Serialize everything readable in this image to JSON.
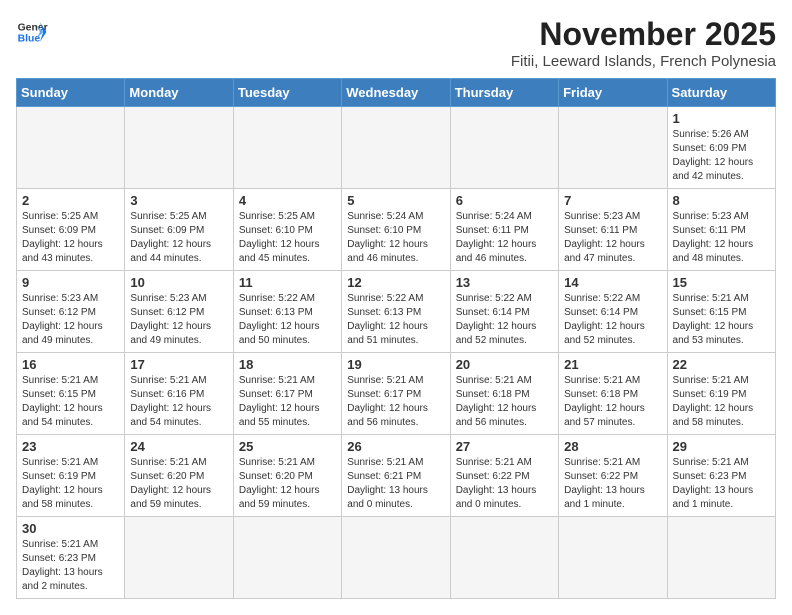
{
  "header": {
    "logo_line1": "General",
    "logo_line2": "Blue",
    "month": "November 2025",
    "location": "Fitii, Leeward Islands, French Polynesia"
  },
  "weekdays": [
    "Sunday",
    "Monday",
    "Tuesday",
    "Wednesday",
    "Thursday",
    "Friday",
    "Saturday"
  ],
  "weeks": [
    [
      {
        "day": "",
        "info": ""
      },
      {
        "day": "",
        "info": ""
      },
      {
        "day": "",
        "info": ""
      },
      {
        "day": "",
        "info": ""
      },
      {
        "day": "",
        "info": ""
      },
      {
        "day": "",
        "info": ""
      },
      {
        "day": "1",
        "info": "Sunrise: 5:26 AM\nSunset: 6:09 PM\nDaylight: 12 hours\nand 42 minutes."
      }
    ],
    [
      {
        "day": "2",
        "info": "Sunrise: 5:25 AM\nSunset: 6:09 PM\nDaylight: 12 hours\nand 43 minutes."
      },
      {
        "day": "3",
        "info": "Sunrise: 5:25 AM\nSunset: 6:09 PM\nDaylight: 12 hours\nand 44 minutes."
      },
      {
        "day": "4",
        "info": "Sunrise: 5:25 AM\nSunset: 6:10 PM\nDaylight: 12 hours\nand 45 minutes."
      },
      {
        "day": "5",
        "info": "Sunrise: 5:24 AM\nSunset: 6:10 PM\nDaylight: 12 hours\nand 46 minutes."
      },
      {
        "day": "6",
        "info": "Sunrise: 5:24 AM\nSunset: 6:11 PM\nDaylight: 12 hours\nand 46 minutes."
      },
      {
        "day": "7",
        "info": "Sunrise: 5:23 AM\nSunset: 6:11 PM\nDaylight: 12 hours\nand 47 minutes."
      },
      {
        "day": "8",
        "info": "Sunrise: 5:23 AM\nSunset: 6:11 PM\nDaylight: 12 hours\nand 48 minutes."
      }
    ],
    [
      {
        "day": "9",
        "info": "Sunrise: 5:23 AM\nSunset: 6:12 PM\nDaylight: 12 hours\nand 49 minutes."
      },
      {
        "day": "10",
        "info": "Sunrise: 5:23 AM\nSunset: 6:12 PM\nDaylight: 12 hours\nand 49 minutes."
      },
      {
        "day": "11",
        "info": "Sunrise: 5:22 AM\nSunset: 6:13 PM\nDaylight: 12 hours\nand 50 minutes."
      },
      {
        "day": "12",
        "info": "Sunrise: 5:22 AM\nSunset: 6:13 PM\nDaylight: 12 hours\nand 51 minutes."
      },
      {
        "day": "13",
        "info": "Sunrise: 5:22 AM\nSunset: 6:14 PM\nDaylight: 12 hours\nand 52 minutes."
      },
      {
        "day": "14",
        "info": "Sunrise: 5:22 AM\nSunset: 6:14 PM\nDaylight: 12 hours\nand 52 minutes."
      },
      {
        "day": "15",
        "info": "Sunrise: 5:21 AM\nSunset: 6:15 PM\nDaylight: 12 hours\nand 53 minutes."
      }
    ],
    [
      {
        "day": "16",
        "info": "Sunrise: 5:21 AM\nSunset: 6:15 PM\nDaylight: 12 hours\nand 54 minutes."
      },
      {
        "day": "17",
        "info": "Sunrise: 5:21 AM\nSunset: 6:16 PM\nDaylight: 12 hours\nand 54 minutes."
      },
      {
        "day": "18",
        "info": "Sunrise: 5:21 AM\nSunset: 6:17 PM\nDaylight: 12 hours\nand 55 minutes."
      },
      {
        "day": "19",
        "info": "Sunrise: 5:21 AM\nSunset: 6:17 PM\nDaylight: 12 hours\nand 56 minutes."
      },
      {
        "day": "20",
        "info": "Sunrise: 5:21 AM\nSunset: 6:18 PM\nDaylight: 12 hours\nand 56 minutes."
      },
      {
        "day": "21",
        "info": "Sunrise: 5:21 AM\nSunset: 6:18 PM\nDaylight: 12 hours\nand 57 minutes."
      },
      {
        "day": "22",
        "info": "Sunrise: 5:21 AM\nSunset: 6:19 PM\nDaylight: 12 hours\nand 58 minutes."
      }
    ],
    [
      {
        "day": "23",
        "info": "Sunrise: 5:21 AM\nSunset: 6:19 PM\nDaylight: 12 hours\nand 58 minutes."
      },
      {
        "day": "24",
        "info": "Sunrise: 5:21 AM\nSunset: 6:20 PM\nDaylight: 12 hours\nand 59 minutes."
      },
      {
        "day": "25",
        "info": "Sunrise: 5:21 AM\nSunset: 6:20 PM\nDaylight: 12 hours\nand 59 minutes."
      },
      {
        "day": "26",
        "info": "Sunrise: 5:21 AM\nSunset: 6:21 PM\nDaylight: 13 hours\nand 0 minutes."
      },
      {
        "day": "27",
        "info": "Sunrise: 5:21 AM\nSunset: 6:22 PM\nDaylight: 13 hours\nand 0 minutes."
      },
      {
        "day": "28",
        "info": "Sunrise: 5:21 AM\nSunset: 6:22 PM\nDaylight: 13 hours\nand 1 minute."
      },
      {
        "day": "29",
        "info": "Sunrise: 5:21 AM\nSunset: 6:23 PM\nDaylight: 13 hours\nand 1 minute."
      }
    ],
    [
      {
        "day": "30",
        "info": "Sunrise: 5:21 AM\nSunset: 6:23 PM\nDaylight: 13 hours\nand 2 minutes."
      },
      {
        "day": "",
        "info": ""
      },
      {
        "day": "",
        "info": ""
      },
      {
        "day": "",
        "info": ""
      },
      {
        "day": "",
        "info": ""
      },
      {
        "day": "",
        "info": ""
      },
      {
        "day": "",
        "info": ""
      }
    ]
  ]
}
